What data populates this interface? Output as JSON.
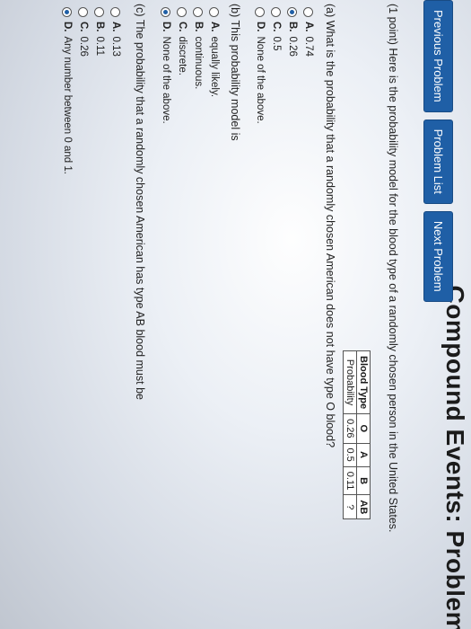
{
  "header": {
    "title": "Compound Events: Problem"
  },
  "nav": {
    "previous": "Previous Problem",
    "list": "Problem List",
    "next": "Next Problem"
  },
  "problem": {
    "intro": "(1 point) Here is the probability model for the blood type of a randomly chosen person in the United States.",
    "table": {
      "header": [
        "Blood Type",
        "O",
        "A",
        "B",
        "AB"
      ],
      "row": [
        "Probability",
        "0.26",
        "0.5",
        "0.11",
        "?"
      ]
    },
    "part_a": {
      "question": "(a) What is the probability that a randomly chosen American does not have type O blood?",
      "options": [
        {
          "letter": "A.",
          "text": "0.74",
          "selected": false
        },
        {
          "letter": "B.",
          "text": "0.26",
          "selected": true
        },
        {
          "letter": "C.",
          "text": "0.5",
          "selected": false
        },
        {
          "letter": "D.",
          "text": "None of the above.",
          "selected": false
        }
      ]
    },
    "part_b": {
      "question": "(b) This probability model is",
      "options": [
        {
          "letter": "A.",
          "text": "equally likely.",
          "selected": false
        },
        {
          "letter": "B.",
          "text": "continuous.",
          "selected": false
        },
        {
          "letter": "C.",
          "text": "discrete.",
          "selected": false
        },
        {
          "letter": "D.",
          "text": "None of the above.",
          "selected": true
        }
      ]
    },
    "part_c": {
      "question": "(c) The probability that a randomly chosen American has type AB blood must be",
      "options": [
        {
          "letter": "A.",
          "text": "0.13",
          "selected": false
        },
        {
          "letter": "B.",
          "text": "0.11",
          "selected": false
        },
        {
          "letter": "C.",
          "text": "0.26",
          "selected": false
        },
        {
          "letter": "D.",
          "text": "Any number between 0 and 1.",
          "selected": true
        }
      ]
    }
  }
}
